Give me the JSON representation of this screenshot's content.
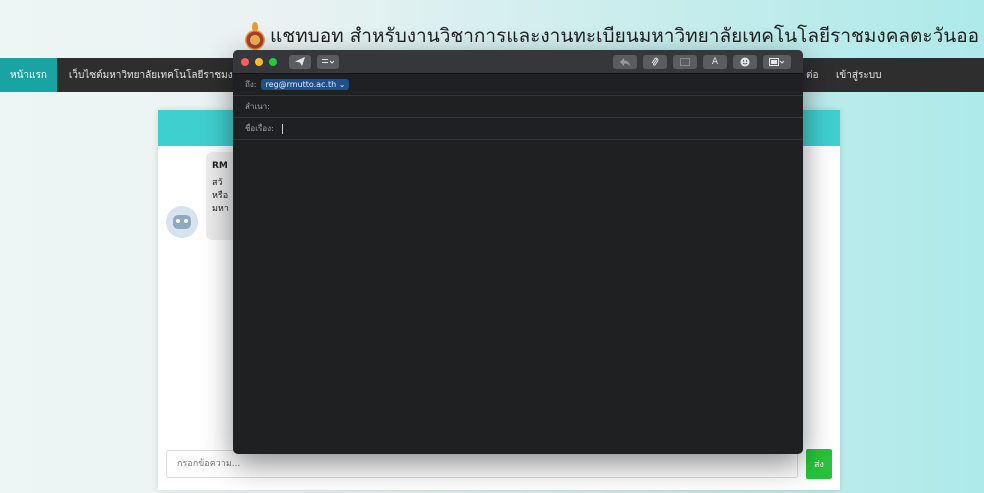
{
  "site": {
    "title": "แชทบอท สำหรับงานวิชาการและงานทะเบียนมหาวิทยาลัยเทคโนโลยีราชมงคลตะวันออ"
  },
  "nav": {
    "home": "หน้าแรก",
    "website": "เว็บไซต์มหาวิทยาลัยเทคโนโลยีราชมงค",
    "contact": "ต่อ",
    "login": "เข้าสู่ระบบ"
  },
  "chat": {
    "bot_name": "RM",
    "message_lines": [
      "สวั",
      "หรือ",
      "มหา"
    ],
    "input_placeholder": "กรอกข้อความ...",
    "send_label": "ส่ง"
  },
  "mail": {
    "to_label": "ถึง:",
    "to_value": "reg@rmutto.ac.th",
    "cc_label": "สำเนา:",
    "subject_label": "ชื่อเรื่อง:",
    "subject_value": "",
    "toolbar": {
      "format_label": "A"
    }
  },
  "colors": {
    "nav_bg": "#2e2e2e",
    "nav_active": "#1aa3a3",
    "chat_header": "#40cfcf",
    "send_button": "#28c33a",
    "mail_bg": "#1f2022",
    "recipient_token": "#1e4f8f",
    "traffic_close": "#fc5f57",
    "traffic_min": "#fdbc2e",
    "traffic_max": "#28c840"
  }
}
